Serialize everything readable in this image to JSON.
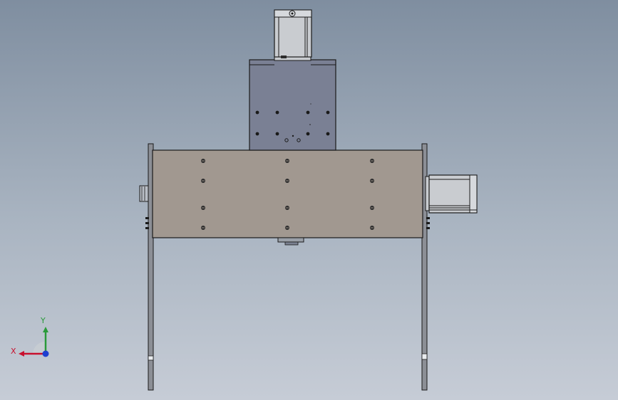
{
  "viewport": {
    "name": "solidworks-front-view",
    "colors": {
      "background_top": "#7f8ea0",
      "background_bottom": "#c6ccd6",
      "plate": "#a19890",
      "carriage": "#7a8094",
      "motor_body": "#c9ccd0",
      "edge": "#1a1a1a",
      "bolt": "#2b2b2b"
    }
  },
  "triad": {
    "x_label": "X",
    "y_label": "Y",
    "x_color": "#c8102e",
    "y_color": "#2a9a3a",
    "z_color": "#1f3fd0"
  },
  "icons": [
    "coordinate-triad-icon"
  ]
}
